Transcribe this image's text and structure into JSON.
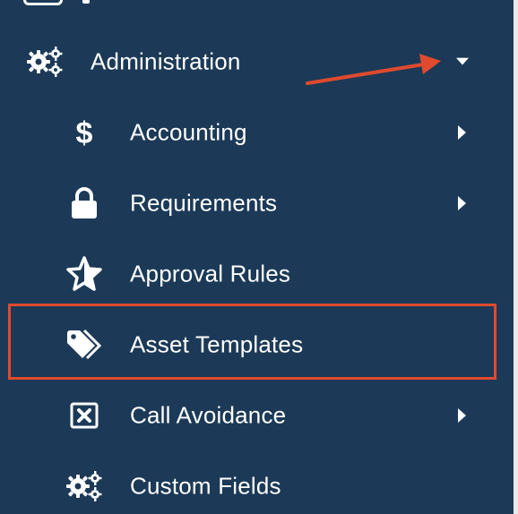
{
  "colors": {
    "sidebar_bg": "#1c3a57",
    "text": "#ffffff",
    "annotation": "#e04a2e"
  },
  "menu": {
    "admin": {
      "label": "Administration",
      "icon": "gears-icon",
      "expanded": true
    },
    "items": [
      {
        "label": "Accounting",
        "icon": "dollar-icon",
        "has_submenu": true
      },
      {
        "label": "Requirements",
        "icon": "lock-icon",
        "has_submenu": true
      },
      {
        "label": "Approval Rules",
        "icon": "star-check-icon",
        "has_submenu": false
      },
      {
        "label": "Asset Templates",
        "icon": "tags-icon",
        "has_submenu": false,
        "highlighted": true
      },
      {
        "label": "Call Avoidance",
        "icon": "x-square-icon",
        "has_submenu": true
      },
      {
        "label": "Custom Fields",
        "icon": "gears-icon",
        "has_submenu": false
      }
    ]
  }
}
